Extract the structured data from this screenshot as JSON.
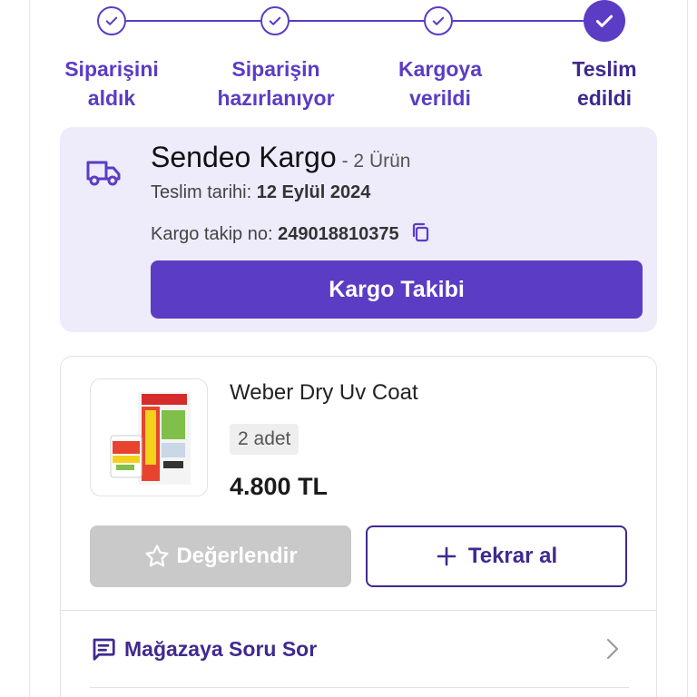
{
  "colors": {
    "primary": "#5b3cc4",
    "primary_dark": "#3f2a8f",
    "card_bg": "#eeebfb",
    "disabled": "#c9c9c9"
  },
  "stepper": {
    "steps": [
      {
        "label_l1": "Siparişini",
        "label_l2": "aldık",
        "state": "done"
      },
      {
        "label_l1": "Siparişin",
        "label_l2": "hazırlanıyor",
        "state": "done"
      },
      {
        "label_l1": "Kargoya",
        "label_l2": "verildi",
        "state": "done"
      },
      {
        "label_l1": "Teslim",
        "label_l2": "edildi",
        "state": "current"
      }
    ]
  },
  "shipment": {
    "icon": "truck-icon",
    "carrier": "Sendeo Kargo",
    "item_count": "- 2 Ürün",
    "delivery_label": "Teslim tarihi:",
    "delivery_date": "12 Eylül 2024",
    "tracking_label": "Kargo takip no:",
    "tracking_no": "249018810375",
    "copy_icon": "copy-icon",
    "track_button": "Kargo Takibi"
  },
  "product": {
    "name": "Weber Dry Uv Coat",
    "quantity": "2 adet",
    "price": "4.800 TL",
    "rate_button": "Değerlendir",
    "rate_icon": "star-icon",
    "reorder_button": "Tekrar al",
    "reorder_icon": "plus-icon"
  },
  "ask_store": {
    "icon": "message-icon",
    "label": "Mağazaya Soru Sor"
  }
}
